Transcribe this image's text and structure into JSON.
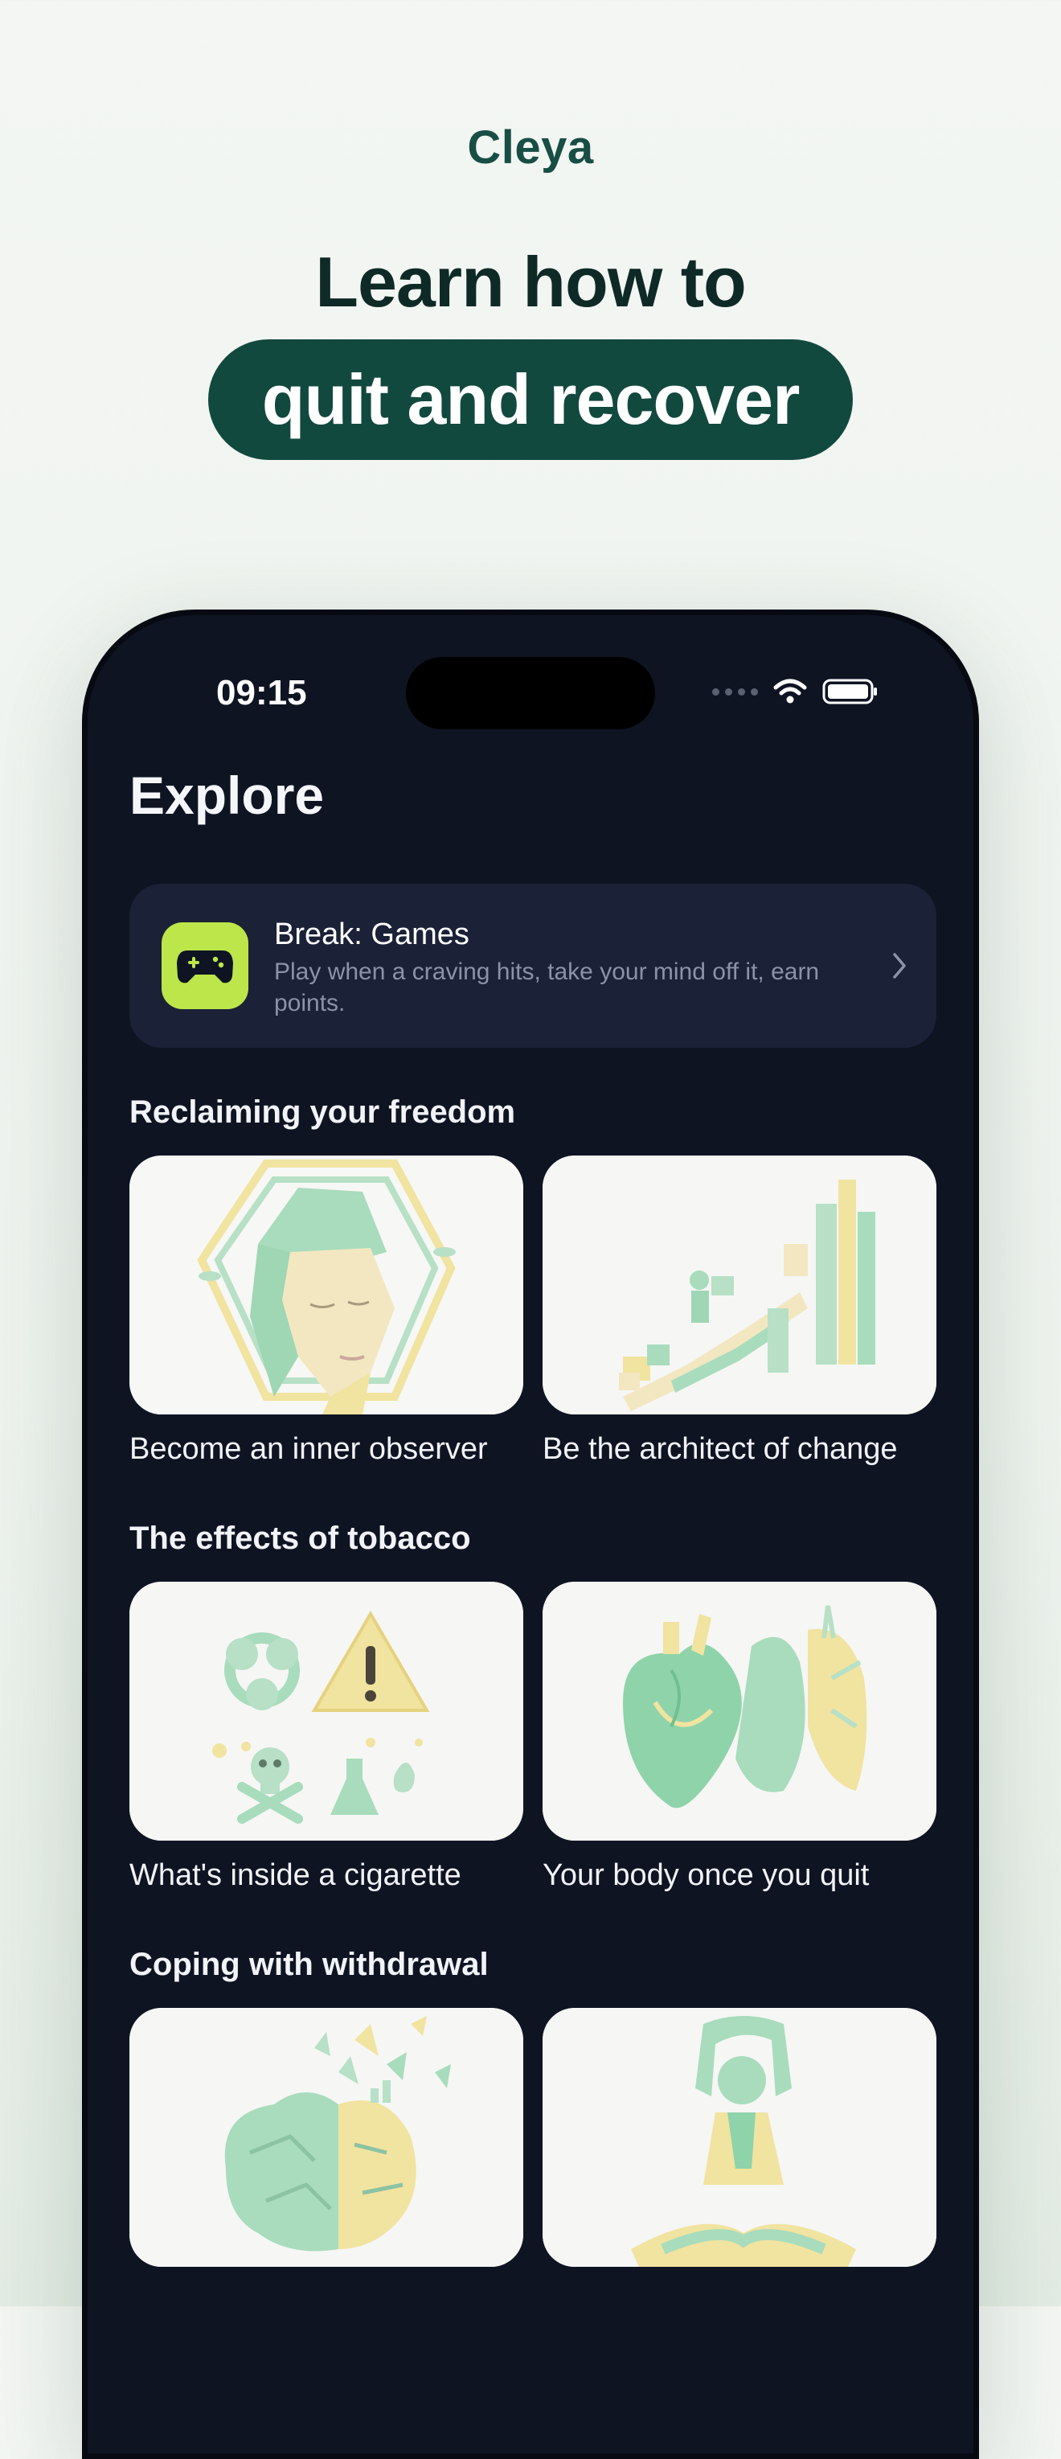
{
  "brand": "Cleya",
  "headline": {
    "line1": "Learn how to",
    "line2": "quit and recover"
  },
  "phone": {
    "status": {
      "time": "09:15"
    },
    "title": "Explore",
    "games_card": {
      "title": "Break: Games",
      "subtitle": "Play when a craving hits, take your mind off it, earn points.",
      "icon": "gamepad-icon",
      "accent": "#bde64a"
    },
    "sections": [
      {
        "title": "Reclaiming your freedom",
        "items": [
          {
            "label": "Become an inner observer",
            "image": "paper-face-illustration"
          },
          {
            "label": "Be the architect of change",
            "image": "paper-stairs-illustration"
          }
        ]
      },
      {
        "title": "The effects of tobacco",
        "items": [
          {
            "label": "What's inside a cigarette",
            "image": "hazard-symbols-illustration"
          },
          {
            "label": "Your body once you quit",
            "image": "heart-lungs-illustration"
          }
        ]
      },
      {
        "title": "Coping with withdrawal",
        "items": [
          {
            "label": "",
            "image": "paper-brain-illustration"
          },
          {
            "label": "",
            "image": "yoga-figure-illustration"
          }
        ]
      }
    ]
  },
  "colors": {
    "background": "#f3f6f3",
    "brand": "#184e45",
    "pill": "#12493f",
    "screen": "#0f1423",
    "card": "#1b2136",
    "paper_green": "#a8dcbc",
    "paper_yellow": "#f1e3a0"
  }
}
